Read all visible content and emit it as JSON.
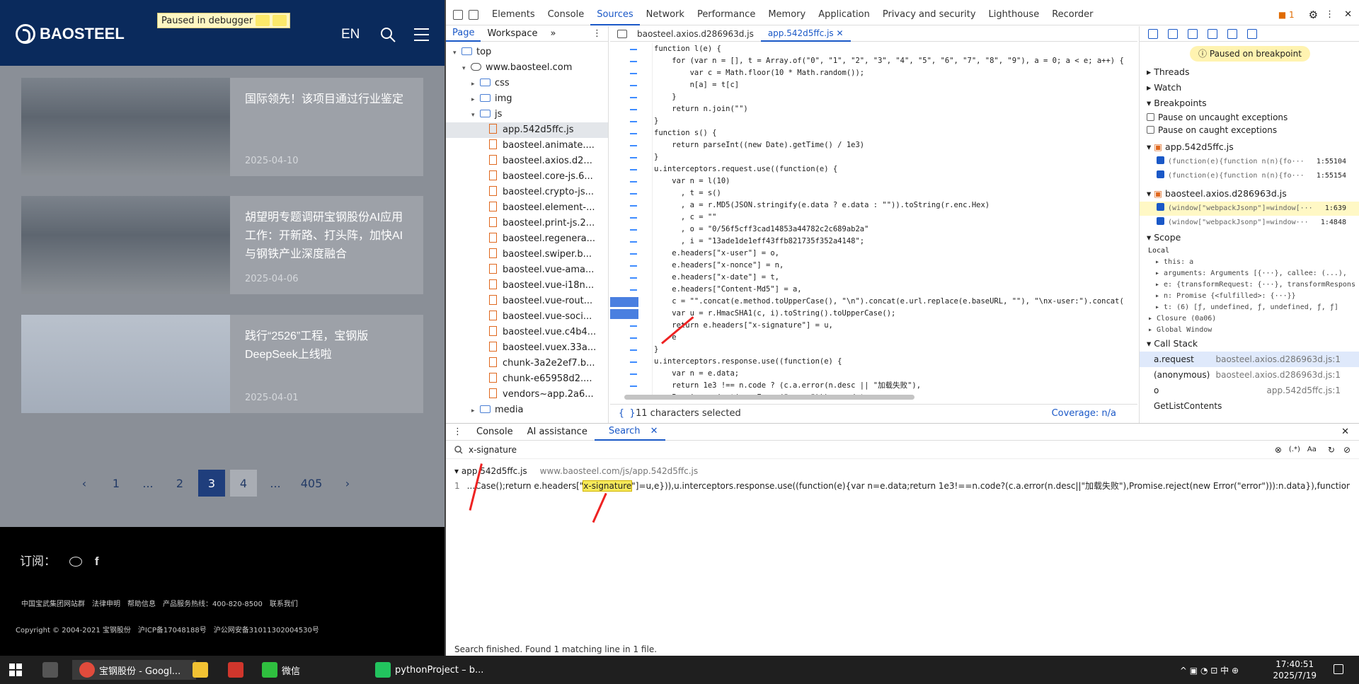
{
  "website": {
    "logo": "BAOSTEEL",
    "lang": "EN",
    "debugger_banner": "Paused in debugger",
    "news": [
      {
        "title": "国际领先！该项目通过行业鉴定",
        "date": "2025-04-10"
      },
      {
        "title": "胡望明专题调研宝钢股份AI应用工作：开新路、打头阵，加快AI与钢铁产业深度融合",
        "date": "2025-04-06"
      },
      {
        "title": "践行“2526”工程，宝钢版DeepSeek上线啦",
        "date": "2025-04-01"
      }
    ],
    "pager": [
      "‹",
      "1",
      "...",
      "2",
      "3",
      "4",
      "...",
      "405",
      "›"
    ],
    "subscribe": "订阅：",
    "footer_links": [
      "中国宝武集团网站群",
      "法律申明",
      "帮助信息",
      "产品服务热线：400-820-8500",
      "联系我们"
    ],
    "copyright": [
      "Copyright © 2004-2021 宝钢股份",
      "沪ICP备17048188号",
      "沪公网安备31011302004530号"
    ]
  },
  "devtools": {
    "tabs": [
      "Elements",
      "Console",
      "Sources",
      "Network",
      "Performance",
      "Memory",
      "Application",
      "Privacy and security",
      "Lighthouse",
      "Recorder"
    ],
    "issues": "1",
    "nav_tabs": [
      "Page",
      "Workspace"
    ],
    "tree": [
      {
        "label": "top",
        "kind": "folder",
        "indent": 0,
        "arrow": "▾"
      },
      {
        "label": "www.baosteel.com",
        "kind": "cloud",
        "indent": 1,
        "arrow": "▾"
      },
      {
        "label": "css",
        "kind": "folder",
        "indent": 2,
        "arrow": "▸"
      },
      {
        "label": "img",
        "kind": "folder",
        "indent": 2,
        "arrow": "▸"
      },
      {
        "label": "js",
        "kind": "folder",
        "indent": 2,
        "arrow": "▾"
      },
      {
        "label": "app.542d5ffc.js",
        "kind": "file",
        "indent": 3,
        "arrow": "",
        "selected": true
      },
      {
        "label": "baosteel.animate....",
        "kind": "file",
        "indent": 3,
        "arrow": ""
      },
      {
        "label": "baosteel.axios.d2...",
        "kind": "file",
        "indent": 3,
        "arrow": ""
      },
      {
        "label": "baosteel.core-js.6...",
        "kind": "file",
        "indent": 3,
        "arrow": ""
      },
      {
        "label": "baosteel.crypto-js...",
        "kind": "file",
        "indent": 3,
        "arrow": ""
      },
      {
        "label": "baosteel.element-...",
        "kind": "file",
        "indent": 3,
        "arrow": ""
      },
      {
        "label": "baosteel.print-js.2...",
        "kind": "file",
        "indent": 3,
        "arrow": ""
      },
      {
        "label": "baosteel.regenera...",
        "kind": "file",
        "indent": 3,
        "arrow": ""
      },
      {
        "label": "baosteel.swiper.b...",
        "kind": "file",
        "indent": 3,
        "arrow": ""
      },
      {
        "label": "baosteel.vue-ama...",
        "kind": "file",
        "indent": 3,
        "arrow": ""
      },
      {
        "label": "baosteel.vue-i18n...",
        "kind": "file",
        "indent": 3,
        "arrow": ""
      },
      {
        "label": "baosteel.vue-rout...",
        "kind": "file",
        "indent": 3,
        "arrow": ""
      },
      {
        "label": "baosteel.vue-soci...",
        "kind": "file",
        "indent": 3,
        "arrow": ""
      },
      {
        "label": "baosteel.vue.c4b4...",
        "kind": "file",
        "indent": 3,
        "arrow": ""
      },
      {
        "label": "baosteel.vuex.33a...",
        "kind": "file",
        "indent": 3,
        "arrow": ""
      },
      {
        "label": "chunk-3a2e2ef7.b...",
        "kind": "file",
        "indent": 3,
        "arrow": ""
      },
      {
        "label": "chunk-e65958d2....",
        "kind": "file",
        "indent": 3,
        "arrow": ""
      },
      {
        "label": "vendors~app.2a6...",
        "kind": "file",
        "indent": 3,
        "arrow": ""
      },
      {
        "label": "media",
        "kind": "folder",
        "indent": 2,
        "arrow": "▸"
      }
    ],
    "editor_tabs": [
      "baosteel.axios.d286963d.js",
      "app.542d5ffc.js"
    ],
    "code": [
      "function l(e) {",
      "    for (var n = [], t = Array.of(\"0\", \"1\", \"2\", \"3\", \"4\", \"5\", \"6\", \"7\", \"8\", \"9\"), a = 0; a < e; a++) {",
      "        var c = Math.floor(10 * Math.random());",
      "        n[a] = t[c]",
      "    }",
      "    return n.join(\"\")",
      "}",
      "function s() {",
      "    return parseInt((new Date).getTime() / 1e3)",
      "}",
      "u.interceptors.request.use((function(e) {",
      "    var n = l(10)",
      "      , t = s()",
      "      , a = r.MD5(JSON.stringify(e.data ? e.data : \"\")).toString(r.enc.Hex)",
      "      , c = \"\"",
      "      , o = \"0/56f5cff3cad14853a44782c2c689ab2a\"",
      "      , i = \"13ade1de1eff43ffb821735f352a4148\";",
      "    e.headers[\"x-user\"] = o,",
      "    e.headers[\"x-nonce\"] = n,",
      "    e.headers[\"x-date\"] = t,",
      "    e.headers[\"Content-Md5\"] = a,",
      "    c = \"\".concat(e.method.toUpperCase(), \"\\n\").concat(e.url.replace(e.baseURL, \"\"), \"\\nx-user:\").concat(",
      "    var u = r.HmacSHA1(c, i).toString().toUpperCase();",
      "    return e.headers[\"x-signature\"] = u,",
      "    e",
      "}",
      "u.interceptors.response.use((function(e) {",
      "    var n = e.data;",
      "    return 1e3 !== n.code ? (c.a.error(n.desc || \"加载失败\"),",
      "    Promise.reject(new Error(\"error\"))) : n.data"
    ],
    "status_left": "{ }",
    "status_sel": "11 characters selected",
    "status_cov": "Coverage: n/a",
    "paused": "Paused on breakpoint",
    "sections": {
      "threads": "Threads",
      "watch": "Watch",
      "breakpoints": "Breakpoints",
      "scope": "Scope",
      "callstack": "Call Stack"
    },
    "pause_opts": [
      "Pause on uncaught exceptions",
      "Pause on caught exceptions"
    ],
    "bp_files": [
      {
        "file": "app.542d5ffc.js",
        "lines": [
          {
            "code": "(function(e){function n(n){fo···",
            "pos": "1:55104"
          },
          {
            "code": "(function(e){function n(n){fo···",
            "pos": "1:55154"
          }
        ]
      },
      {
        "file": "baosteel.axios.d286963d.js",
        "lines": [
          {
            "code": "(window[\"webpackJsonp\"]=window[···",
            "pos": "1:639",
            "hl": true
          },
          {
            "code": "(window[\"webpackJsonp\"]=window···",
            "pos": "1:4848"
          }
        ]
      }
    ],
    "scope": [
      "Local",
      "▸ this: a",
      "▸ arguments: Arguments [{···}, callee: (...),",
      "▸ e: {transformRequest: {···}, transformRespons",
      "▸ n: Promise {<fulfilled>: {···}}",
      "▸ t: (6) [ƒ, undefined, ƒ, undefined, ƒ, ƒ]",
      "▸ Closure (0a06)",
      "▸ Global                                   Window"
    ],
    "callstack": [
      {
        "fn": "a.request",
        "file": "baosteel.axios.d286963d.js:1",
        "on": true
      },
      {
        "fn": "(anonymous)",
        "file": "baosteel.axios.d286963d.js:1"
      },
      {
        "fn": "o",
        "file": "app.542d5ffc.js:1"
      },
      {
        "fn": "GetListContents",
        "file": ""
      }
    ],
    "drawer_tabs": [
      "Console",
      "AI assistance",
      "Search"
    ],
    "search_value": "x-signature",
    "search_opts": [
      "(.*)",
      "Aa"
    ],
    "result_file": "app.542d5ffc.js",
    "result_url": "www.baosteel.com/js/app.542d5ffc.js",
    "result_line_no": "1",
    "result_pre": "...Case();return e.headers[\"",
    "result_match": "x-signature",
    "result_post": "\"]=u,e})),u.interceptors.response.use((function(e){var n=e.data;return 1e3!==n.code?(c.a.error(n.desc||\"加载失败\"),Promise.reject(new Error(\"error\"))):n.data}),function(e){return Promise....",
    "search_status": "Search finished.  Found 1 matching line in 1 file."
  },
  "taskbar": {
    "items": [
      "宝钢股份 - Googl...",
      "微信",
      "pythonProject – b..."
    ],
    "tray": "中",
    "time": "17:40:51",
    "date": "2025/7/19"
  }
}
